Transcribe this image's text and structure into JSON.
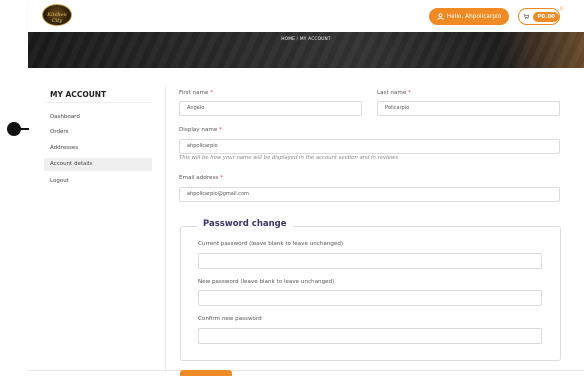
{
  "header": {
    "logo_text": "Kitchen City",
    "hello_label": "Hello, Ahpolicarpio",
    "cart_amount": "P0.00",
    "cart_count": "0"
  },
  "hero": {
    "breadcrumb": "HOME / MY ACCOUNT"
  },
  "sidebar": {
    "heading": "MY ACCOUNT",
    "items": [
      {
        "label": "Dashboard"
      },
      {
        "label": "Orders"
      },
      {
        "label": "Addresses"
      },
      {
        "label": "Account details"
      },
      {
        "label": "Logout"
      }
    ]
  },
  "form": {
    "first_name": {
      "label": "First name",
      "required": "*",
      "value": "Angelo"
    },
    "last_name": {
      "label": "Last name",
      "required": "*",
      "value": "Policarpio"
    },
    "display_name": {
      "label": "Display name",
      "required": "*",
      "value": "ahpolicarpio",
      "hint": "This will be how your name will be displayed in the account section and in reviews"
    },
    "email": {
      "label": "Email address",
      "required": "*",
      "value": "ahpolicarpio@gmail.com"
    },
    "password": {
      "legend": "Password change",
      "current_label": "Current password (leave blank to leave unchanged)",
      "new_label": "New password (leave blank to leave unchanged)",
      "confirm_label": "Confirm new password"
    }
  },
  "colors": {
    "accent": "#f08a24",
    "legend": "#3a3366"
  }
}
